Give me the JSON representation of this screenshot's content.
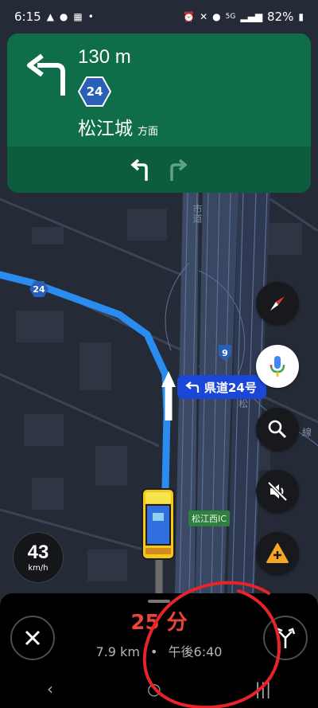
{
  "status_bar": {
    "time": "6:15",
    "signal": "5G",
    "battery": "82%"
  },
  "nav_card": {
    "distance": "130 m",
    "route_number": "24",
    "destination": "松江城",
    "destination_suffix": "方面"
  },
  "map": {
    "street_label": "県道24号",
    "ic_label": "松江西IC",
    "road_label_vertical": "市道",
    "road_label_side": "松",
    "road_label_side2": "線",
    "shield_24": "24",
    "shield_9": "9"
  },
  "speed": {
    "value": "43",
    "unit": "km/h"
  },
  "bottom_panel": {
    "eta_time": "25 分",
    "distance": "7.9 km",
    "separator": "•",
    "arrival": "午後6:40"
  },
  "colors": {
    "nav_green": "#0f6d4a",
    "route_blue": "#2b8cf0",
    "eta_red": "#e8453c",
    "label_blue": "#1a47d8"
  }
}
